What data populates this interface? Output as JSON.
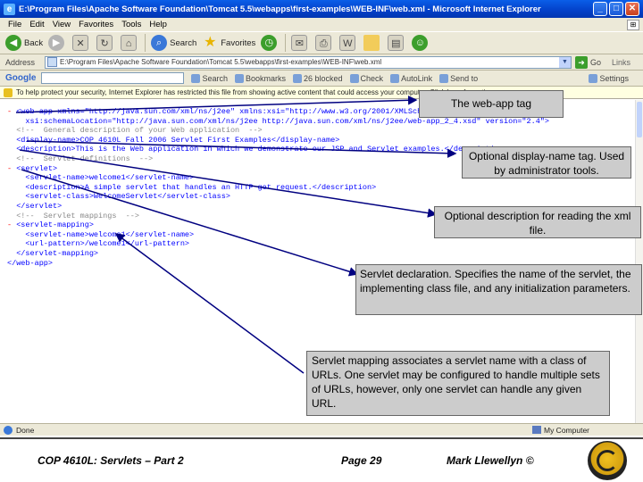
{
  "window": {
    "title": "E:\\Program Files\\Apache Software Foundation\\Tomcat 5.5\\webapps\\first-examples\\WEB-INF\\web.xml - Microsoft Internet Explorer",
    "buttons": {
      "minimize": "_",
      "maximize": "□",
      "close": "✕"
    }
  },
  "menubar": [
    "File",
    "Edit",
    "View",
    "Favorites",
    "Tools",
    "Help"
  ],
  "toolbar": {
    "back": "Back",
    "search": "Search",
    "favorites": "Favorites"
  },
  "address": {
    "label": "Address",
    "value": "E:\\Program Files\\Apache Software Foundation\\Tomcat 5.5\\webapps\\first-examples\\WEB-INF\\web.xml",
    "go": "Go",
    "links": "Links"
  },
  "google_bar": {
    "logo": "Google",
    "search_label": "Search",
    "bookmarks": "Bookmarks",
    "blocked": "26 blocked",
    "check": "Check",
    "autolink": "AutoLink",
    "send_to": "Send to",
    "settings": "Settings"
  },
  "infobar": {
    "text": "To help protect your security, Internet Explorer has restricted this file from showing active content that could access your computer. Click here for options..."
  },
  "xml_lines": [
    {
      "tog": "- ",
      "text": "<web-app xmlns=\"http://java.sun.com/xml/ns/j2ee\" xmlns:xsi=\"http://www.w3.org/2001/XMLSchema-instance\""
    },
    {
      "tog": "",
      "text": "    xsi:schemaLocation=\"http://java.sun.com/xml/ns/j2ee http://java.sun.com/xml/ns/j2ee/web-app_2_4.xsd\" version=\"2.4\">"
    },
    {
      "tog": "",
      "text": "  <!--  General description of your Web application  -->"
    },
    {
      "tog": "",
      "text": "  <display-name>COP 4610L Fall 2006 Servlet First Examples</display-name>"
    },
    {
      "tog": "",
      "text": "  <description>This is the Web application in which we demonstrate our JSP and Servlet examples.</description>"
    },
    {
      "tog": "",
      "text": "  <!--  Servlet definitions  -->"
    },
    {
      "tog": "- ",
      "text": "<servlet>"
    },
    {
      "tog": "",
      "text": "    <servlet-name>welcome1</servlet-name>"
    },
    {
      "tog": "",
      "text": "    <description>A simple servlet that handles an HTTP get request.</description>"
    },
    {
      "tog": "",
      "text": "    <servlet-class>WelcomeServlet</servlet-class>"
    },
    {
      "tog": "",
      "text": "  </servlet>"
    },
    {
      "tog": "",
      "text": "  <!--  Servlet mappings  -->"
    },
    {
      "tog": "- ",
      "text": "<servlet-mapping>"
    },
    {
      "tog": "",
      "text": "    <servlet-name>welcome1</servlet-name>"
    },
    {
      "tog": "",
      "text": "    <url-pattern>/welcome1</url-pattern>"
    },
    {
      "tog": "",
      "text": "  </servlet-mapping>"
    },
    {
      "tog": "",
      "text": "</web-app>"
    }
  ],
  "status": {
    "left": "Done",
    "zone": "My Computer"
  },
  "callouts": {
    "webapp_tag": "The web-app tag",
    "display_name": "Optional display-name tag. Used by administrator tools.",
    "description": "Optional description for reading the xml file.",
    "servlet_decl": "Servlet declaration.  Specifies the name of the servlet, the implementing class file, and any initialization parameters.",
    "servlet_mapping": "Servlet mapping associates a servlet name with a class of URLs.  One servlet may be configured to handle multiple sets of URLs, however, only one servlet can handle any given URL."
  },
  "footer": {
    "course": "COP 4610L: Servlets – Part 2",
    "page": "Page 29",
    "author": "Mark Llewellyn ©"
  },
  "colors": {
    "titlebar": "#0a5ee8",
    "xml_markup": "#0000ff",
    "callout_bg": "#cccccc"
  }
}
